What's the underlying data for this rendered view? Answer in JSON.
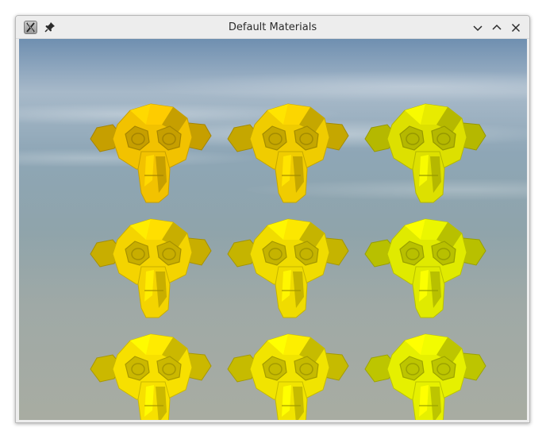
{
  "window": {
    "title": "Default Materials",
    "icons": {
      "app": "app-x-icon",
      "pin": "pin-icon",
      "minimize": "chevron-down-icon",
      "maximize": "chevron-up-icon",
      "close": "close-icon"
    }
  },
  "scene": {
    "sky_colors": [
      "#6f8fb0",
      "#a7b9c9",
      "#8fa4ab",
      "#a8aca2"
    ],
    "monkeys": [
      {
        "row": 1,
        "col": 1,
        "color": "#f2c200"
      },
      {
        "row": 1,
        "col": 2,
        "color": "#f0cc00"
      },
      {
        "row": 1,
        "col": 3,
        "color": "#dde000"
      },
      {
        "row": 2,
        "col": 1,
        "color": "#f4d400"
      },
      {
        "row": 2,
        "col": 2,
        "color": "#f0dc00"
      },
      {
        "row": 2,
        "col": 3,
        "color": "#e0ea00"
      },
      {
        "row": 3,
        "col": 1,
        "color": "#f7e000"
      },
      {
        "row": 3,
        "col": 2,
        "color": "#f1e400"
      },
      {
        "row": 3,
        "col": 3,
        "color": "#e6f000"
      }
    ]
  }
}
